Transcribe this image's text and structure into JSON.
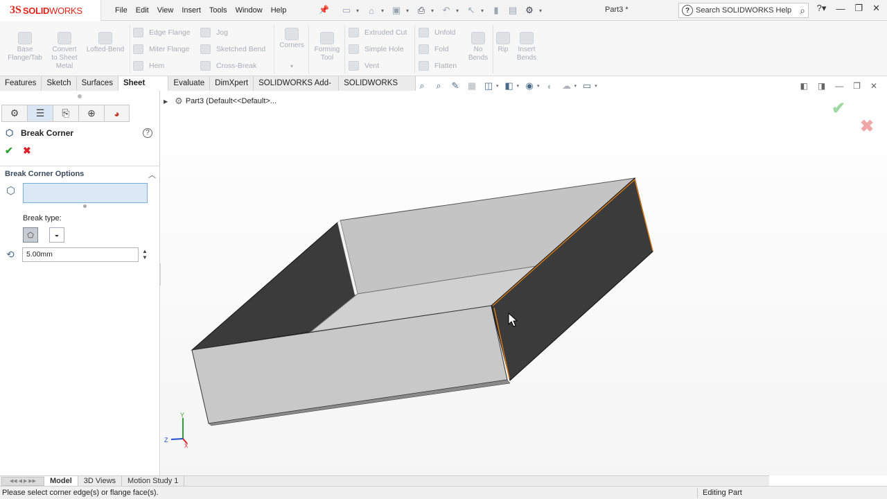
{
  "app": {
    "logo_ds": "3S",
    "logo_text_bold": "SOLID",
    "logo_text": "WORKS",
    "document_title": "Part3 *"
  },
  "menu": [
    "File",
    "Edit",
    "View",
    "Insert",
    "Tools",
    "Window",
    "Help"
  ],
  "search": {
    "placeholder": "Search SOLIDWORKS Help"
  },
  "ribbon": {
    "base_flange": "Base\nFlange/Tab",
    "convert": "Convert\nto Sheet\nMetal",
    "lofted_bend": "Lofted-Bend",
    "edge_flange": "Edge Flange",
    "miter_flange": "Miter Flange",
    "hem": "Hem",
    "jog": "Jog",
    "sketched_bend": "Sketched Bend",
    "cross_break": "Cross-Break",
    "corners": "Corners",
    "forming_tool": "Forming\nTool",
    "extruded_cut": "Extruded Cut",
    "simple_hole": "Simple Hole",
    "vent": "Vent",
    "unfold": "Unfold",
    "fold": "Fold",
    "flatten": "Flatten",
    "no_bends": "No\nBends",
    "rip": "Rip",
    "insert_bends": "Insert\nBends"
  },
  "tabs": [
    "Features",
    "Sketch",
    "Surfaces",
    "Sheet Metal",
    "Evaluate",
    "DimXpert",
    "SOLIDWORKS Add-Ins",
    "SOLIDWORKS MBD"
  ],
  "active_tab": "Sheet Metal",
  "property_manager": {
    "title": "Break Corner",
    "group_title": "Break Corner Options",
    "break_type_label": "Break type:",
    "distance_value": "5.00mm"
  },
  "tree_flyout": {
    "text": "Part3  (Default<<Default>..."
  },
  "triad": {
    "x": "X",
    "y": "Y",
    "z": "Z"
  },
  "bottom_tabs": [
    "Model",
    "3D Views",
    "Motion Study 1"
  ],
  "status": {
    "message": "Please select corner edge(s) or flange face(s).",
    "mode": "Editing Part"
  },
  "colors": {
    "brand_red": "#e2231a",
    "accept_green": "#2fa134",
    "cancel_red": "#d8232a",
    "selection_box": "#dbe9f6",
    "dark_face": "#3b3b3b",
    "light_face": "#c4c4c4",
    "edge_highlight": "#d97c1a"
  }
}
